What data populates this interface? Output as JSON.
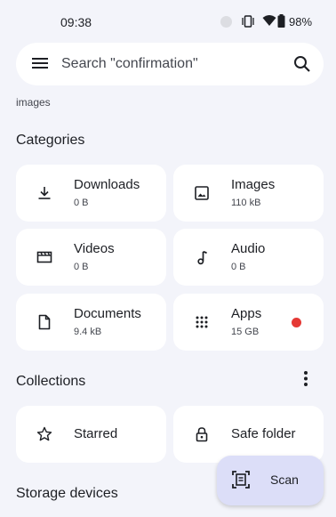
{
  "status": {
    "time": "09:38",
    "battery": "98%"
  },
  "search": {
    "placeholder": "Search \"confirmation\""
  },
  "recent": {
    "caption": "images"
  },
  "categories": {
    "title": "Categories",
    "items": [
      {
        "name": "Downloads",
        "size": "0 B",
        "icon": "download-icon"
      },
      {
        "name": "Images",
        "size": "110 kB",
        "icon": "image-icon"
      },
      {
        "name": "Videos",
        "size": "0 B",
        "icon": "video-icon"
      },
      {
        "name": "Audio",
        "size": "0 B",
        "icon": "music-note-icon"
      },
      {
        "name": "Documents",
        "size": "9.4 kB",
        "icon": "document-icon"
      },
      {
        "name": "Apps",
        "size": "15 GB",
        "icon": "apps-grid-icon"
      }
    ]
  },
  "collections": {
    "title": "Collections",
    "items": [
      {
        "name": "Starred",
        "icon": "star-icon"
      },
      {
        "name": "Safe folder",
        "icon": "lock-icon"
      }
    ]
  },
  "storage": {
    "title": "Storage devices"
  },
  "fab": {
    "label": "Scan",
    "icon": "document-scanner-icon"
  },
  "colors": {
    "background": "#f3f4fa",
    "card": "#ffffff",
    "fab": "#dcdef8",
    "alert": "#e53935"
  }
}
